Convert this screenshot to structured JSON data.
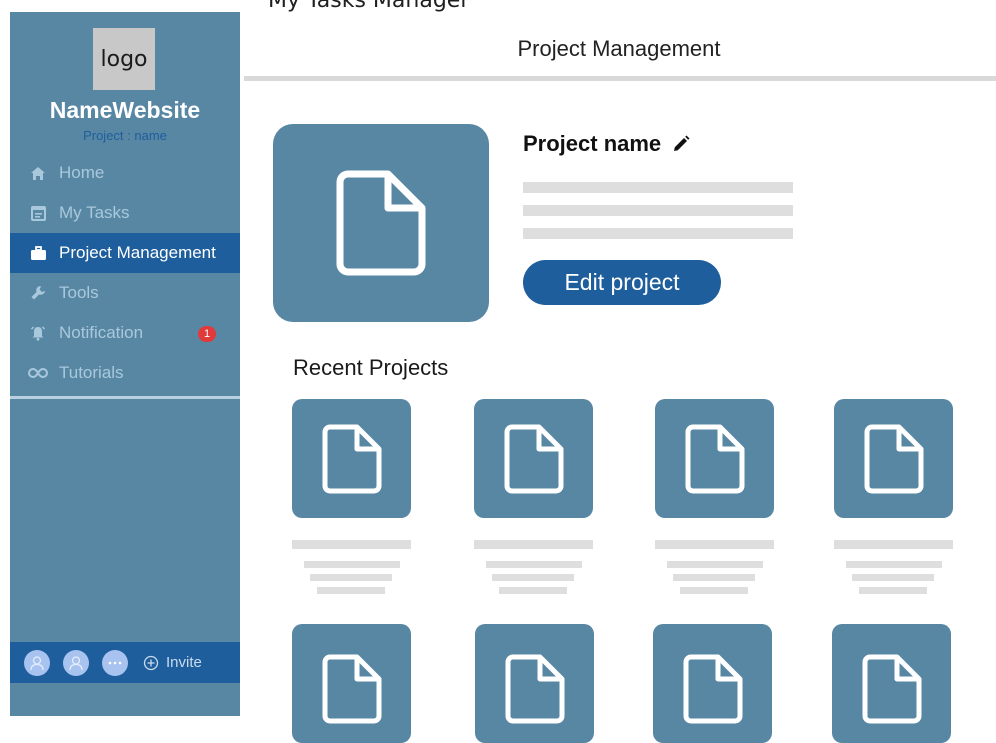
{
  "header": {
    "cropped_top_text": "My Tasks Manager",
    "title": "Project Management"
  },
  "sidebar": {
    "logo_text": "logo",
    "site_name": "NameWebsite",
    "project_label": "Project : name",
    "items": [
      {
        "label": "Home",
        "icon": "home-icon"
      },
      {
        "label": "My Tasks",
        "icon": "calendar-icon"
      },
      {
        "label": "Project Management",
        "icon": "briefcase-icon",
        "active": true
      },
      {
        "label": "Tools",
        "icon": "wrench-icon"
      },
      {
        "label": "Notification",
        "icon": "alarm-icon",
        "badge": "1"
      },
      {
        "label": "Tutorials",
        "icon": "infinity-icon"
      }
    ],
    "footer": {
      "invite_label": "Invite"
    }
  },
  "project": {
    "name": "Project name",
    "edit_label": "Edit project"
  },
  "recent": {
    "title": "Recent Projects"
  },
  "colors": {
    "sidebar_bg": "#5887a4",
    "accent": "#1e5e9c",
    "placeholder": "#dedede",
    "badge": "#e03a3a"
  }
}
